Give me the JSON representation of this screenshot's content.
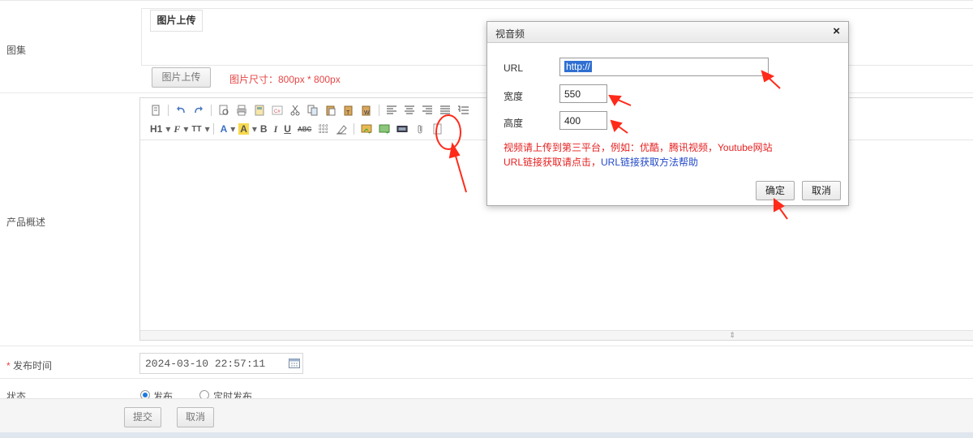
{
  "form": {
    "gallery_label": "图集",
    "gallery_tab": "图片上传",
    "upload_button": "图片上传",
    "size_hint": "图片尺寸：800px * 800px",
    "desc_label": "产品概述",
    "toolbar": {
      "heading_btn": "H1",
      "font_btn": "F",
      "size_btn": "TT",
      "color_btn": "A",
      "bg_btn": "A",
      "bold_btn": "B",
      "italic_btn": "I",
      "underline_btn": "U",
      "strike_btn": "ABC"
    },
    "publish_time_label": "发布时间",
    "required_mark": "*",
    "publish_time_value": "2024-03-10 22:57:11",
    "status_label": "状态",
    "status_options": [
      "发布",
      "定时发布"
    ],
    "submit_button": "提交",
    "cancel_button": "取消"
  },
  "dialog": {
    "title": "视音频",
    "close": "×",
    "url_label": "URL",
    "url_value": "http://",
    "width_label": "宽度",
    "width_value": "550",
    "height_label": "高度",
    "height_value": "400",
    "note_line1": "视频请上传到第三平台，例如：优酷，腾讯视频，Youtube网站",
    "note_line2_red": "URL链接获取请点击，",
    "note_line2_blue": "URL链接获取方法帮助",
    "ok_button": "确定",
    "cancel_button": "取消"
  },
  "colors": {
    "required": "#e64545",
    "selection": "#2f6fd1",
    "annotation": "#ff2a1a",
    "help_link": "#2349c9"
  }
}
